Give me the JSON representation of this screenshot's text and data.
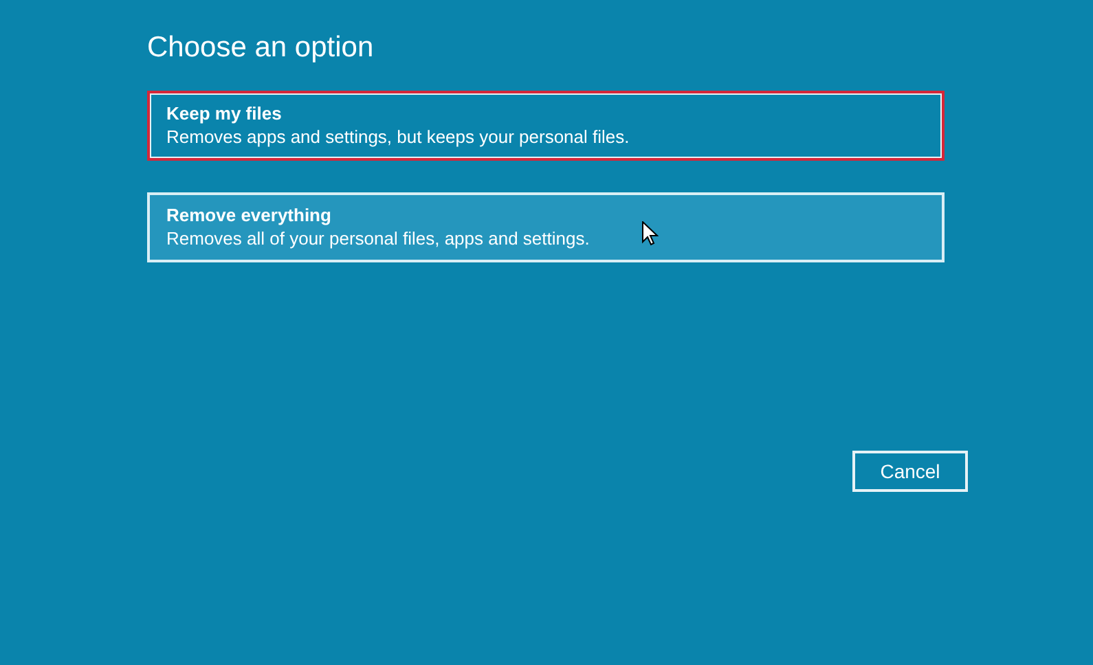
{
  "title": "Choose an option",
  "options": [
    {
      "title": "Keep my files",
      "description": "Removes apps and settings, but keeps your personal files.",
      "hovered": false,
      "highlighted": true
    },
    {
      "title": "Remove everything",
      "description": "Removes all of your personal files, apps and settings.",
      "hovered": true,
      "highlighted": false
    }
  ],
  "buttons": [
    "Cancel"
  ]
}
